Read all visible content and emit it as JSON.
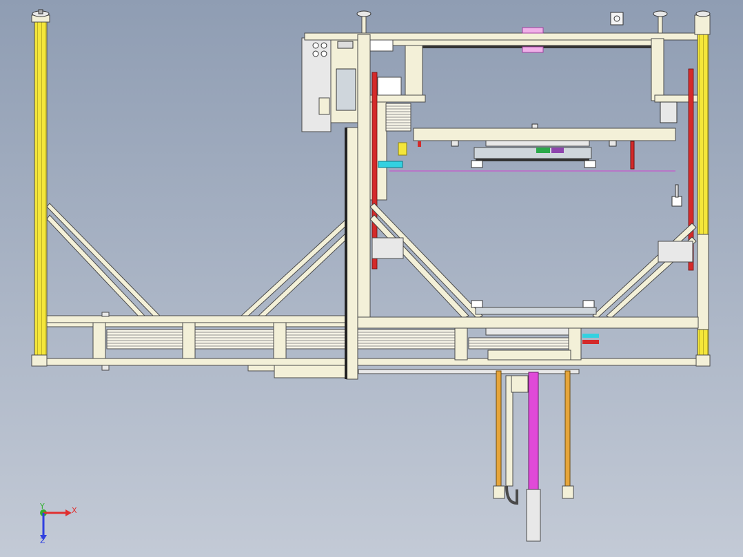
{
  "viewport": {
    "background_top": "#8f9db3",
    "background_bottom": "#c3cad6"
  },
  "colors": {
    "frame_fill": "#f3f0d8",
    "frame_stroke": "#4a4a4a",
    "upright_yellow": "#f4e63a",
    "actuator_red": "#d42a2a",
    "rail_magenta": "#e04ad8",
    "rail_orange": "#e6a53a",
    "accent_cyan": "#33d1e0",
    "panel_gray": "#e8e8e8"
  },
  "triad": {
    "x_label": "X",
    "y_label": "Y",
    "z_label": "Z",
    "x_color": "#e03030",
    "y_color": "#30b030",
    "z_color": "#3040e0"
  },
  "icons": {
    "view_cube": "view-orientation-icon"
  }
}
